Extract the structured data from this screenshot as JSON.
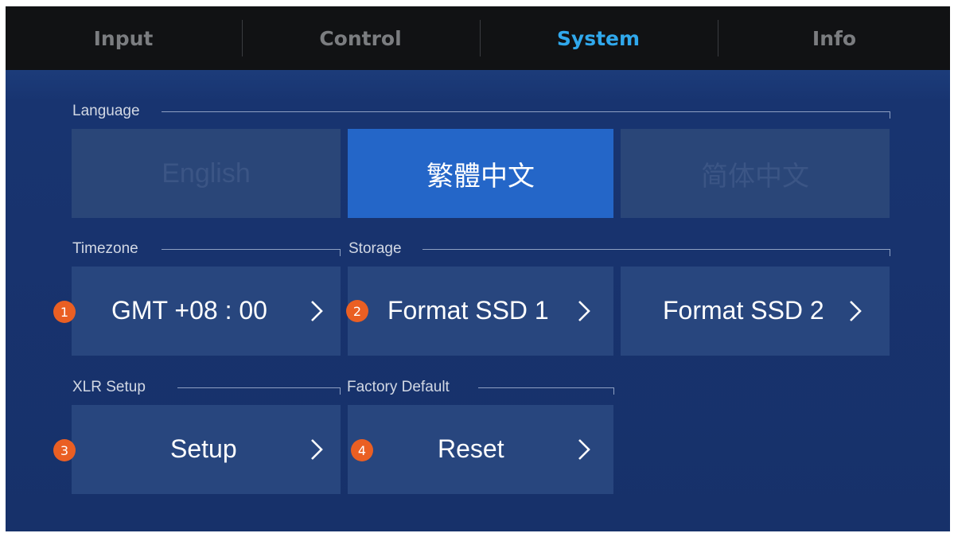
{
  "tabs": [
    {
      "label": "Input",
      "active": false
    },
    {
      "label": "Control",
      "active": false
    },
    {
      "label": "System",
      "active": true
    },
    {
      "label": "Info",
      "active": false
    }
  ],
  "colors": {
    "accent": "#30a8ec",
    "selected": "#2466c8",
    "badge": "#ea5f23",
    "panel": "#17316a",
    "button": "#28467e"
  },
  "language": {
    "label": "Language",
    "options": [
      "English",
      "繁體中文",
      "简体中文"
    ],
    "selected": "繁體中文"
  },
  "timezone": {
    "label": "Timezone",
    "value": "GMT +08 : 00",
    "badge": "1",
    "icon": "chevron-right-icon"
  },
  "storage": {
    "label": "Storage",
    "ssd1": "Format SSD 1",
    "ssd1_badge": "2",
    "ssd2": "Format SSD 2",
    "icon": "chevron-right-icon"
  },
  "xlr": {
    "label": "XLR Setup",
    "button": "Setup",
    "badge": "3",
    "icon": "chevron-right-icon"
  },
  "factory": {
    "label": "Factory Default",
    "button": "Reset",
    "badge": "4",
    "icon": "chevron-right-icon"
  }
}
